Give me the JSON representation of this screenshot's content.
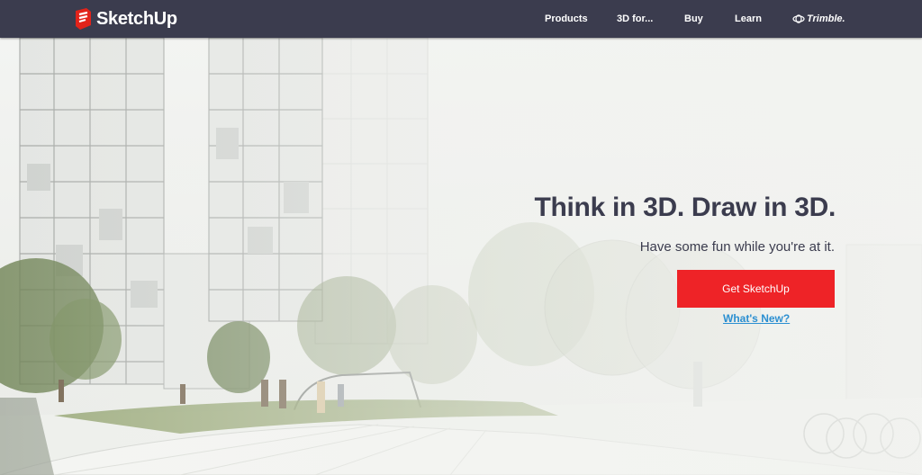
{
  "header": {
    "brand": "SketchUp",
    "nav": [
      "Products",
      "3D for...",
      "Buy",
      "Learn"
    ],
    "partner": "Trimble."
  },
  "hero": {
    "headline": "Think in 3D. Draw in 3D.",
    "subline": "Have some fun while you're at it.",
    "cta_label": "Get SketchUp",
    "link_label": "What's New?"
  },
  "colors": {
    "topbar": "#3b3c4e",
    "cta": "#ee2327",
    "link": "#2b8fd1",
    "text": "#3b3c4e"
  },
  "icons": {
    "brand": "sketchup-logo-icon",
    "partner": "trimble-logo-icon"
  }
}
